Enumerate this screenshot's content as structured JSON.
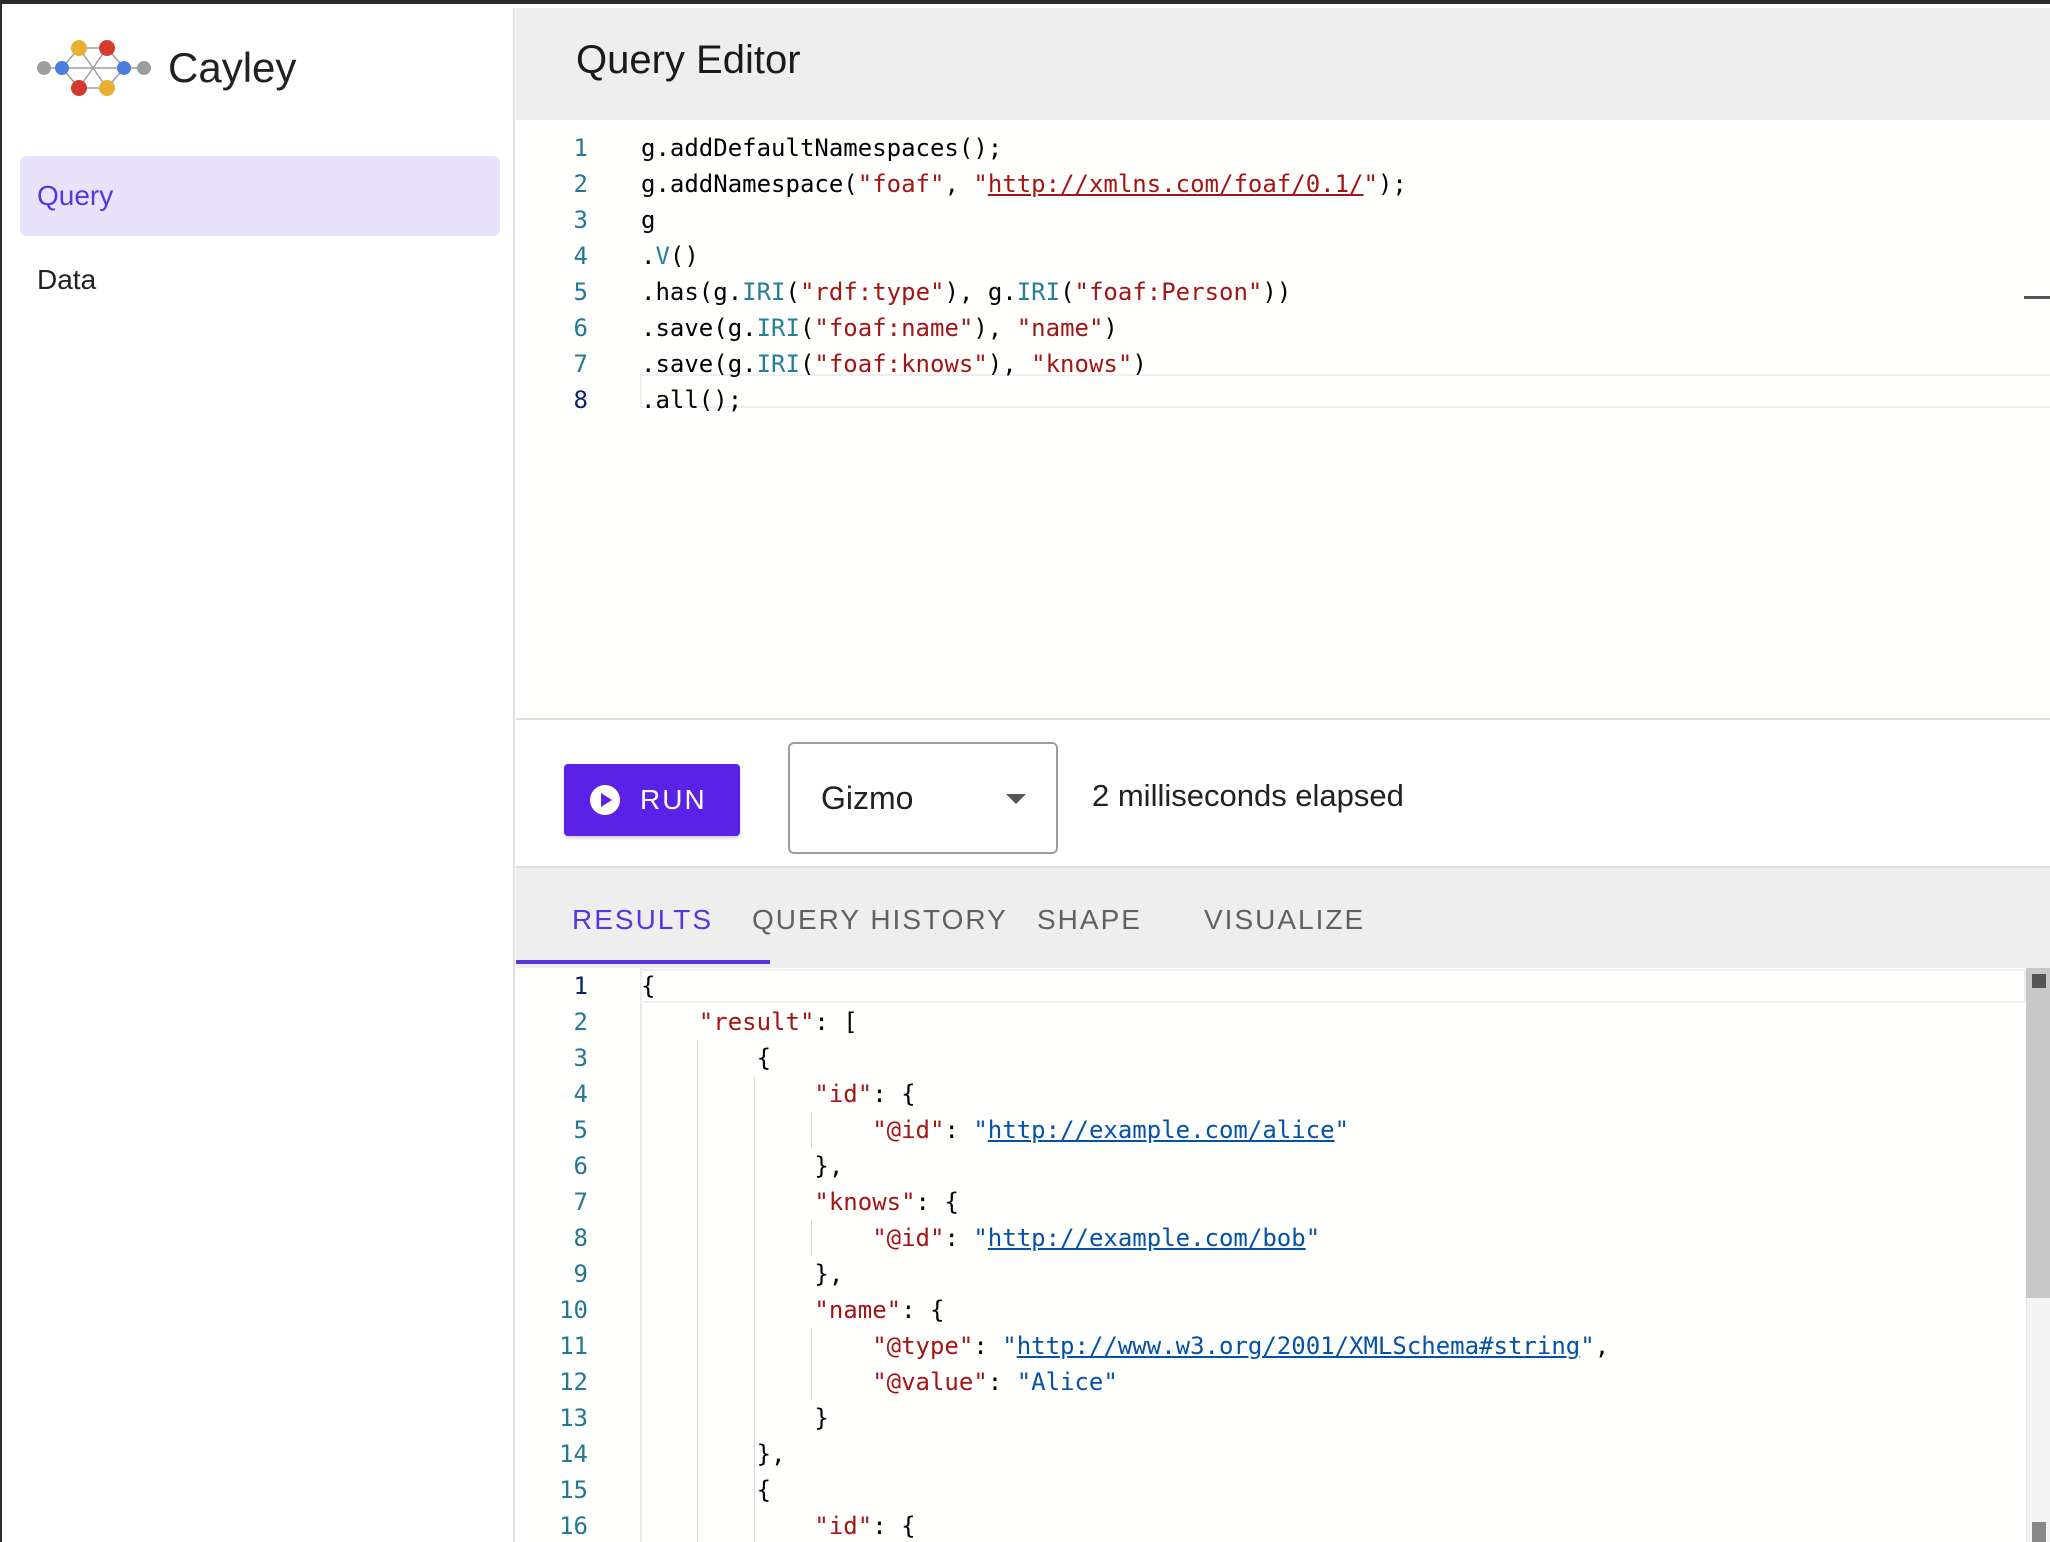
{
  "app": {
    "name": "Cayley"
  },
  "sidebar": {
    "items": [
      {
        "label": "Query",
        "active": true
      },
      {
        "label": "Data",
        "active": false
      }
    ]
  },
  "header": {
    "title": "Query Editor"
  },
  "editor": {
    "lines": [
      {
        "n": "1",
        "tokens": [
          {
            "t": "g.addDefaultNamespaces();",
            "c": ""
          }
        ]
      },
      {
        "n": "2",
        "tokens": [
          {
            "t": "g.addNamespace(",
            "c": ""
          },
          {
            "t": "\"foaf\"",
            "c": "s-str"
          },
          {
            "t": ", ",
            "c": ""
          },
          {
            "t": "\"",
            "c": "s-str"
          },
          {
            "t": "http://xmlns.com/foaf/0.1/",
            "c": "s-link"
          },
          {
            "t": "\"",
            "c": "s-str"
          },
          {
            "t": ");",
            "c": ""
          }
        ]
      },
      {
        "n": "3",
        "tokens": [
          {
            "t": "g",
            "c": ""
          }
        ]
      },
      {
        "n": "4",
        "tokens": [
          {
            "t": ".",
            "c": ""
          },
          {
            "t": "V",
            "c": "s-fn"
          },
          {
            "t": "()",
            "c": ""
          }
        ]
      },
      {
        "n": "5",
        "tokens": [
          {
            "t": ".has(g.",
            "c": ""
          },
          {
            "t": "IRI",
            "c": "s-fn"
          },
          {
            "t": "(",
            "c": ""
          },
          {
            "t": "\"rdf:type\"",
            "c": "s-str"
          },
          {
            "t": "), g.",
            "c": ""
          },
          {
            "t": "IRI",
            "c": "s-fn"
          },
          {
            "t": "(",
            "c": ""
          },
          {
            "t": "\"foaf:Person\"",
            "c": "s-str"
          },
          {
            "t": "))",
            "c": ""
          }
        ]
      },
      {
        "n": "6",
        "tokens": [
          {
            "t": ".save(g.",
            "c": ""
          },
          {
            "t": "IRI",
            "c": "s-fn"
          },
          {
            "t": "(",
            "c": ""
          },
          {
            "t": "\"foaf:name\"",
            "c": "s-str"
          },
          {
            "t": "), ",
            "c": ""
          },
          {
            "t": "\"name\"",
            "c": "s-str"
          },
          {
            "t": ")",
            "c": ""
          }
        ]
      },
      {
        "n": "7",
        "tokens": [
          {
            "t": ".save(g.",
            "c": ""
          },
          {
            "t": "IRI",
            "c": "s-fn"
          },
          {
            "t": "(",
            "c": ""
          },
          {
            "t": "\"foaf:knows\"",
            "c": "s-str"
          },
          {
            "t": "), ",
            "c": ""
          },
          {
            "t": "\"knows\"",
            "c": "s-str"
          },
          {
            "t": ")",
            "c": ""
          }
        ]
      },
      {
        "n": "8",
        "tokens": [
          {
            "t": ".all();",
            "c": ""
          }
        ],
        "current": true
      }
    ]
  },
  "toolbar": {
    "run_label": "RUN",
    "language": "Gizmo",
    "elapsed": "2 milliseconds elapsed"
  },
  "tabs": [
    {
      "label": "RESULTS",
      "active": true
    },
    {
      "label": "QUERY HISTORY",
      "active": false
    },
    {
      "label": "SHAPE",
      "active": false
    },
    {
      "label": "VISUALIZE",
      "active": false
    }
  ],
  "results": {
    "lines": [
      {
        "n": "1",
        "tokens": [
          {
            "t": "{",
            "c": ""
          }
        ],
        "current": true
      },
      {
        "n": "2",
        "tokens": [
          {
            "t": "    ",
            "c": ""
          },
          {
            "t": "\"result\"",
            "c": "s-key"
          },
          {
            "t": ": [",
            "c": ""
          }
        ]
      },
      {
        "n": "3",
        "tokens": [
          {
            "t": "        {",
            "c": ""
          }
        ]
      },
      {
        "n": "4",
        "tokens": [
          {
            "t": "            ",
            "c": ""
          },
          {
            "t": "\"id\"",
            "c": "s-key"
          },
          {
            "t": ": {",
            "c": ""
          }
        ]
      },
      {
        "n": "5",
        "tokens": [
          {
            "t": "                ",
            "c": ""
          },
          {
            "t": "\"@id\"",
            "c": "s-key"
          },
          {
            "t": ": ",
            "c": ""
          },
          {
            "t": "\"",
            "c": "s-val"
          },
          {
            "t": "http://example.com/alice",
            "c": "s-vlink"
          },
          {
            "t": "\"",
            "c": "s-val"
          }
        ]
      },
      {
        "n": "6",
        "tokens": [
          {
            "t": "            },",
            "c": ""
          }
        ]
      },
      {
        "n": "7",
        "tokens": [
          {
            "t": "            ",
            "c": ""
          },
          {
            "t": "\"knows\"",
            "c": "s-key"
          },
          {
            "t": ": {",
            "c": ""
          }
        ]
      },
      {
        "n": "8",
        "tokens": [
          {
            "t": "                ",
            "c": ""
          },
          {
            "t": "\"@id\"",
            "c": "s-key"
          },
          {
            "t": ": ",
            "c": ""
          },
          {
            "t": "\"",
            "c": "s-val"
          },
          {
            "t": "http://example.com/bob",
            "c": "s-vlink"
          },
          {
            "t": "\"",
            "c": "s-val"
          }
        ]
      },
      {
        "n": "9",
        "tokens": [
          {
            "t": "            },",
            "c": ""
          }
        ]
      },
      {
        "n": "10",
        "tokens": [
          {
            "t": "            ",
            "c": ""
          },
          {
            "t": "\"name\"",
            "c": "s-key"
          },
          {
            "t": ": {",
            "c": ""
          }
        ]
      },
      {
        "n": "11",
        "tokens": [
          {
            "t": "                ",
            "c": ""
          },
          {
            "t": "\"@type\"",
            "c": "s-key"
          },
          {
            "t": ": ",
            "c": ""
          },
          {
            "t": "\"",
            "c": "s-val"
          },
          {
            "t": "http://www.w3.org/2001/XMLSchema#string",
            "c": "s-vlink"
          },
          {
            "t": "\"",
            "c": "s-val"
          },
          {
            "t": ",",
            "c": ""
          }
        ]
      },
      {
        "n": "12",
        "tokens": [
          {
            "t": "                ",
            "c": ""
          },
          {
            "t": "\"@value\"",
            "c": "s-key"
          },
          {
            "t": ": ",
            "c": ""
          },
          {
            "t": "\"Alice\"",
            "c": "s-val"
          }
        ]
      },
      {
        "n": "13",
        "tokens": [
          {
            "t": "            }",
            "c": ""
          }
        ]
      },
      {
        "n": "14",
        "tokens": [
          {
            "t": "        },",
            "c": ""
          }
        ]
      },
      {
        "n": "15",
        "tokens": [
          {
            "t": "        {",
            "c": ""
          }
        ]
      },
      {
        "n": "16",
        "tokens": [
          {
            "t": "            ",
            "c": ""
          },
          {
            "t": "\"id\"",
            "c": "s-key"
          },
          {
            "t": ": {",
            "c": ""
          }
        ]
      }
    ]
  },
  "colors": {
    "accent": "#5b21e6",
    "active_nav_bg": "#e8e3fb",
    "string": "#a31515",
    "value": "#0451a5",
    "function": "#267f99"
  },
  "icons": {
    "logo": "cayley-graph-logo",
    "run": "play-circle-icon",
    "select": "caret-down-icon"
  }
}
